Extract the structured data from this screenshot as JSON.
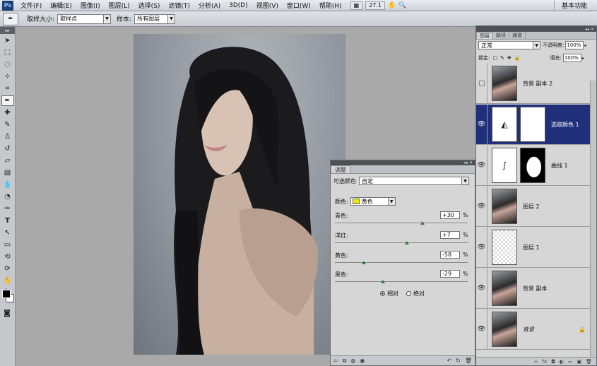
{
  "menubar": {
    "logo": "Ps",
    "items": [
      "文件(F)",
      "编辑(E)",
      "图像(I)",
      "图层(L)",
      "选择(S)",
      "滤镜(T)",
      "分析(A)",
      "3D(D)",
      "视图(V)",
      "窗口(W)",
      "帮助(H)"
    ],
    "zoom": "27.1",
    "workspace": "基本功能"
  },
  "options": {
    "sample_size_label": "取样大小:",
    "sample_size_value": "取样点",
    "sample_label": "样本:",
    "sample_value": "所有图层"
  },
  "adjustments": {
    "tab": "调整",
    "preset_label": "可选颜色",
    "preset_value": "自定",
    "color_label": "颜色:",
    "color_value": "黄色",
    "color_swatch": "#f0e800",
    "sliders": [
      {
        "label": "青色:",
        "value": "+30",
        "unit": "%"
      },
      {
        "label": "洋红:",
        "value": "+7",
        "unit": "%"
      },
      {
        "label": "黄色:",
        "value": "-58",
        "unit": "%"
      },
      {
        "label": "黑色:",
        "value": "-29",
        "unit": "%"
      }
    ],
    "method_relative": "相对",
    "method_absolute": "绝对"
  },
  "layers": {
    "tabs": [
      "图层",
      "路径",
      "通道"
    ],
    "blend_mode": "正常",
    "opacity_label": "不透明度:",
    "opacity_value": "100%",
    "lock_label": "锁定:",
    "fill_label": "填充:",
    "fill_value": "100%",
    "items": [
      {
        "name": "背景 副本 2",
        "visible": false,
        "selected": false
      },
      {
        "name": "选取颜色 1",
        "visible": true,
        "selected": true
      },
      {
        "name": "曲线 1",
        "visible": true,
        "selected": false
      },
      {
        "name": "图层 2",
        "visible": true,
        "selected": false
      },
      {
        "name": "图层 1",
        "visible": true,
        "selected": false
      },
      {
        "name": "背景 副本",
        "visible": true,
        "selected": false
      },
      {
        "name": "背景",
        "visible": true,
        "selected": false
      }
    ]
  }
}
